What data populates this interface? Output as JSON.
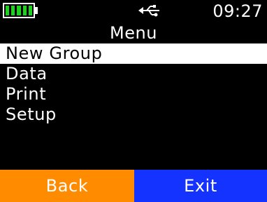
{
  "status": {
    "battery_icon": "battery-full-icon",
    "battery_level": 1.0,
    "battery_color": "#1fd21f",
    "usb_icon": "usb-icon",
    "time": "09:27"
  },
  "title": "Menu",
  "menu": {
    "items": [
      {
        "label": "New Group",
        "selected": true
      },
      {
        "label": "Data",
        "selected": false
      },
      {
        "label": "Print",
        "selected": false
      },
      {
        "label": "Setup",
        "selected": false
      }
    ]
  },
  "softkeys": {
    "left": {
      "label": "Back",
      "color": "#ff8c00"
    },
    "right": {
      "label": "Exit",
      "color": "#1533ff"
    }
  },
  "colors": {
    "background": "#000000",
    "text": "#ffffff",
    "selection_background": "#ffffff",
    "selection_text": "#000000"
  }
}
